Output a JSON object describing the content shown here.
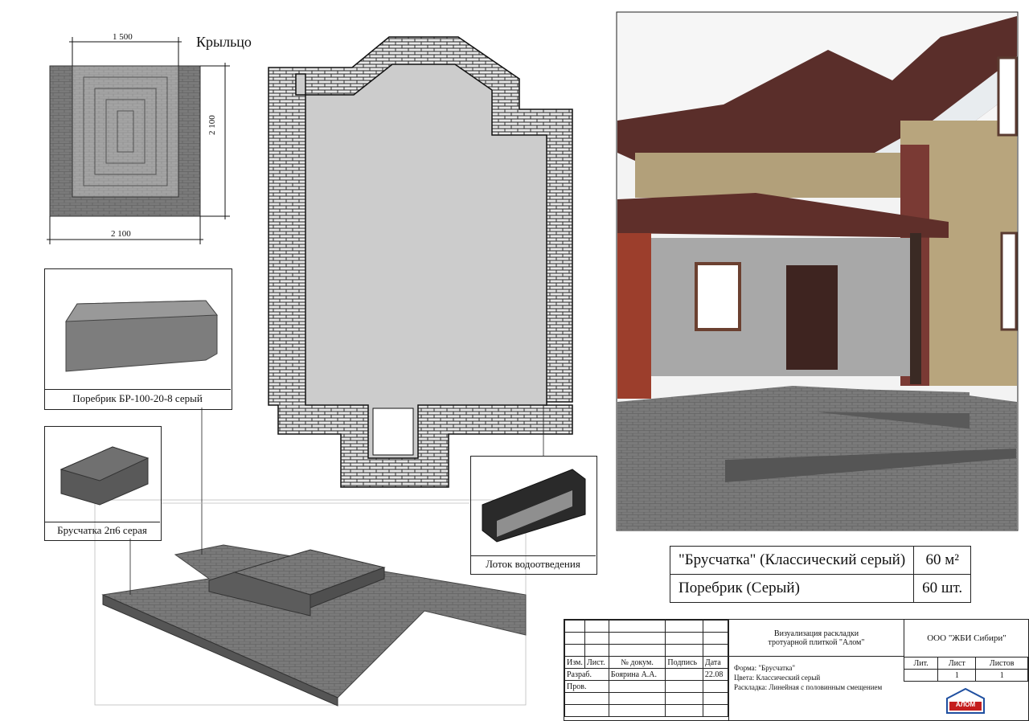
{
  "porch": {
    "title": "Крыльцо",
    "dim_top": "1 500",
    "dim_right": "2 100",
    "dim_bottom": "2 100"
  },
  "items": {
    "curb_label": "Поребрик БР-100-20-8 серый",
    "paver_label": "Брусчатка 2п6 серая",
    "drain_label": "Лоток водоотведения"
  },
  "quantities": [
    {
      "name": "\"Брусчатка\" (Классический серый)",
      "amount": "60 м²"
    },
    {
      "name": "Поребрик (Серый)",
      "amount": "60 шт."
    }
  ],
  "title_block": {
    "headers": {
      "izm": "Изм.",
      "list": "Лист.",
      "doc": "№ докум.",
      "sign": "Подпись",
      "date": "Дата"
    },
    "row_develop": {
      "label": "Разраб.",
      "name": "Боярина А.А.",
      "date": "22.08"
    },
    "row_check": {
      "label": "Пров."
    },
    "project_title_1": "Визуализация раскладки",
    "project_title_2": "тротуарной плиткой \"Алом\"",
    "company": "ООО \"ЖБИ Сибири\"",
    "spec_1": "Форма: \"Брусчатка\"",
    "spec_2": "Цвета: Классический серый",
    "spec_3": "Раскладка: Линейная с половинным смещением",
    "lit_label": "Лит.",
    "sheet_label": "Лист",
    "sheets_label": "Листов",
    "sheet_value": "1",
    "sheets_value": "1",
    "logo_text": "АЛОМ"
  },
  "colors": {
    "paver_dark": "#6a6a6a",
    "paver_light": "#9a9a9a",
    "brick_fill": "#d0d0d0",
    "plan_fill": "#cccccc",
    "logo_red": "#c41e1e",
    "logo_blue": "#1f4fa0"
  }
}
